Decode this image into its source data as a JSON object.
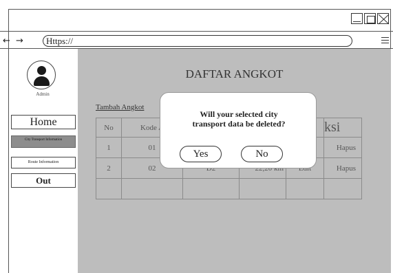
{
  "window": {
    "controls": [
      "minimize-icon",
      "maximize-icon",
      "close-icon"
    ]
  },
  "browser": {
    "back_forward": "← →",
    "url": "Https://",
    "menu_icon": "hamburger-menu-icon"
  },
  "sidebar": {
    "avatar_icon": "user-avatar-icon",
    "user_label": "Admin",
    "items": [
      {
        "label": "Home"
      },
      {
        "label": "City Transport Information"
      },
      {
        "label": "Route Information"
      },
      {
        "label": "Out"
      }
    ]
  },
  "main": {
    "title": "DAFTAR ANGKOT",
    "add_link": "Tambah Angkot",
    "table": {
      "headers": [
        "No",
        "Kode A",
        "",
        "",
        "",
        "ksi"
      ],
      "rows": [
        [
          "1",
          "01",
          "",
          "",
          "",
          "Hapus"
        ],
        [
          "2",
          "02",
          "D2",
          "22,20 km",
          "Edit",
          "Hapus"
        ]
      ]
    }
  },
  "dialog": {
    "message_line1": "Will your selected city",
    "message_line2": "transport data be deleted?",
    "yes_label": "Yes",
    "no_label": "No"
  }
}
